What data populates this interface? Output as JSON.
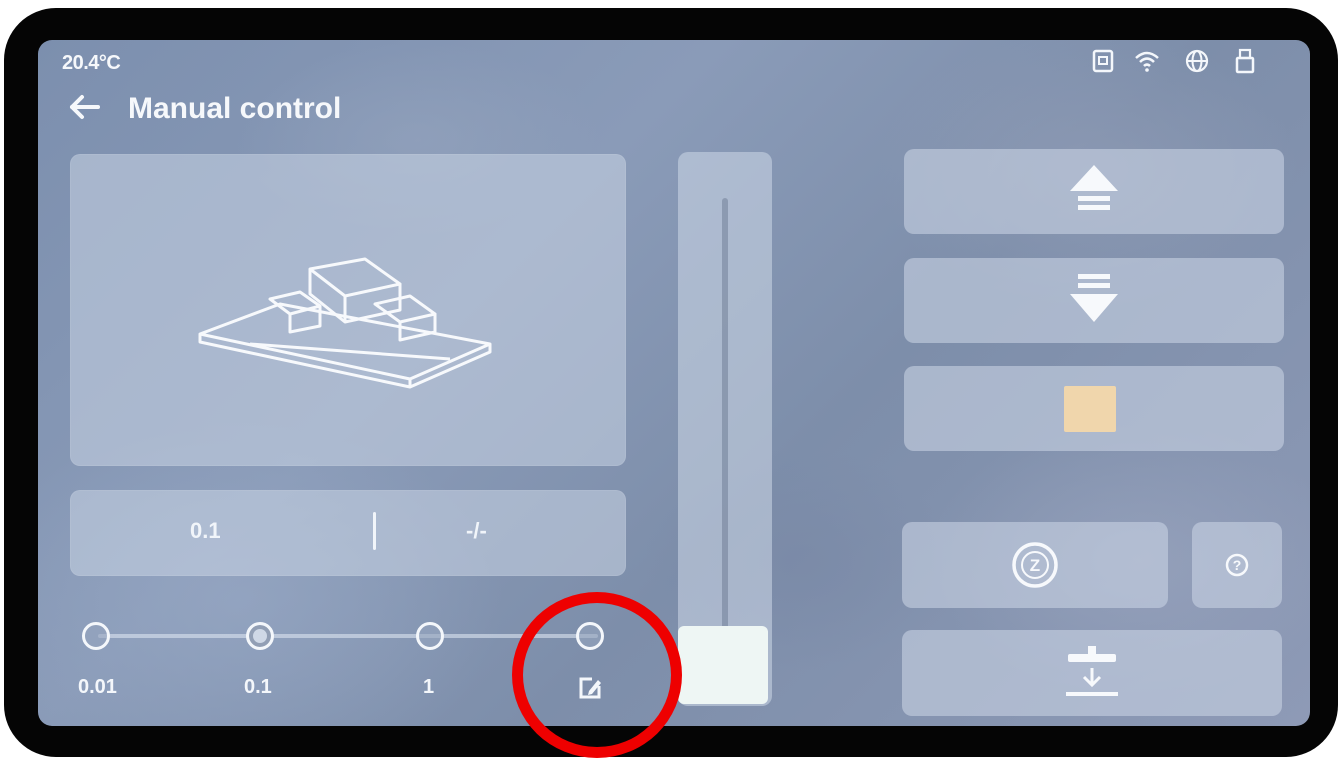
{
  "status_bar": {
    "temperature": "20.4°C",
    "icons": [
      "usb-drive-icon",
      "wifi-icon",
      "globe-icon",
      "lock-icon"
    ]
  },
  "header": {
    "title": "Manual control",
    "back_icon": "back-arrow-icon"
  },
  "preview": {
    "image": "printer-platform-illustration"
  },
  "values_panel": {
    "left_value": "0.1",
    "right_value": "-/-"
  },
  "step_selector": {
    "options": [
      {
        "label": "0.01"
      },
      {
        "label": "0.1"
      },
      {
        "label": "1"
      },
      {
        "icon": "edit-icon"
      }
    ]
  },
  "buttons": {
    "move_up": "arrow-up-icon",
    "move_down": "arrow-down-icon",
    "stop": "stop-icon",
    "home_z": "home-z-icon",
    "help": "help-icon",
    "level": "level-platform-icon",
    "home_z_label": "Z",
    "help_label": "?"
  },
  "colors": {
    "stop_square": "#f0d6ac",
    "highlight": "#ee0000"
  }
}
